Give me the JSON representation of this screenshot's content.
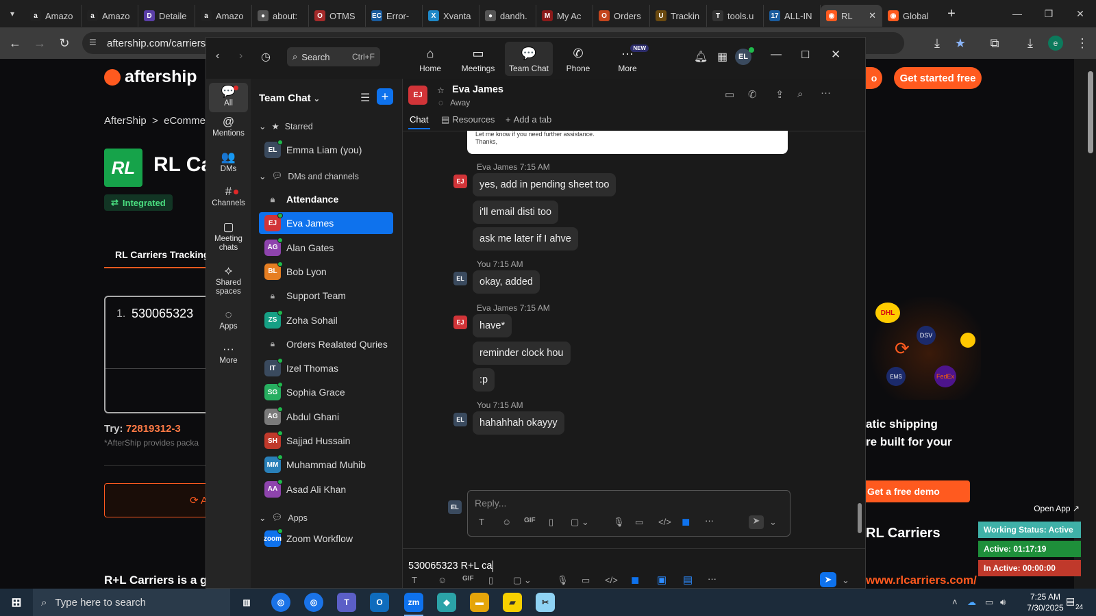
{
  "browser": {
    "tabs": [
      {
        "label": "Amazo",
        "fav": "a",
        "color": "#222"
      },
      {
        "label": "Amazo",
        "fav": "a",
        "color": "#222"
      },
      {
        "label": "Detaile",
        "fav": "D",
        "color": "#5a3ea6"
      },
      {
        "label": "Amazo",
        "fav": "a",
        "color": "#222"
      },
      {
        "label": "about:",
        "fav": "●",
        "color": "#555"
      },
      {
        "label": "OTMS",
        "fav": "O",
        "color": "#a42a2a"
      },
      {
        "label": "Error-",
        "fav": "EC",
        "color": "#1a5c9e"
      },
      {
        "label": "Xvanta",
        "fav": "X",
        "color": "#1e88c7"
      },
      {
        "label": "dandh.",
        "fav": "●",
        "color": "#555"
      },
      {
        "label": "My Ac",
        "fav": "M",
        "color": "#8b1a1a"
      },
      {
        "label": "Orders",
        "fav": "O",
        "color": "#c4451d"
      },
      {
        "label": "Trackin",
        "fav": "U",
        "color": "#6b4a10"
      },
      {
        "label": "tools.u",
        "fav": "T",
        "color": "#333"
      },
      {
        "label": "ALL-IN",
        "fav": "17",
        "color": "#1a5c9e"
      }
    ],
    "active_tab": {
      "label": "RL",
      "fav": "◉",
      "color": "#ff5a1f"
    },
    "last_tab": {
      "label": "Global",
      "fav": "◉",
      "color": "#ff5a1f"
    },
    "url": "aftership.com/carriers/r",
    "profile_initial": "e"
  },
  "bg_page": {
    "logo": "aftership",
    "breadcrumb": "AfterShip  >  eCommer",
    "carrier_title": "RL Ca",
    "carrier_logo": "RL",
    "integrated_badge": "Integrated",
    "tab_label": "RL Carriers Tracking",
    "tracking_index": "1.",
    "tracking_number": "530065323",
    "try_label": "Try:",
    "try_number": "72819312-3",
    "note": "*AfterShip provides packa",
    "footer_text": "R+L Carriers is a glo",
    "get_started": "Get started free",
    "partial_btn": "o",
    "promo_line1": "atic shipping",
    "promo_line2": "re built for your",
    "demo_button": "Get a free demo",
    "rl_carriers": "RL Carriers",
    "rl_url": "www.rlcarriers.com/",
    "carriers": [
      "DHL",
      "DSV",
      "FedEx",
      "EMS"
    ]
  },
  "zoom": {
    "topnav": [
      {
        "label": "Home",
        "icon": "⌂"
      },
      {
        "label": "Meetings",
        "icon": "▭"
      },
      {
        "label": "Team Chat",
        "icon": "💬"
      },
      {
        "label": "Phone",
        "icon": "✆"
      },
      {
        "label": "More",
        "icon": "···",
        "badge": "NEW"
      }
    ],
    "search_label": "Search",
    "search_shortcut": "Ctrl+F",
    "user_initials": "EL",
    "rail": [
      {
        "label": "All",
        "icon": "💬"
      },
      {
        "label": "Mentions",
        "icon": "@"
      },
      {
        "label": "DMs",
        "icon": "👥"
      },
      {
        "label": "Channels",
        "icon": "#"
      },
      {
        "label": "Meeting chats",
        "icon": "▢"
      },
      {
        "label": "Shared spaces",
        "icon": "⟡"
      },
      {
        "label": "Apps",
        "icon": "◌"
      },
      {
        "label": "More",
        "icon": "···"
      }
    ],
    "list_title": "Team Chat",
    "sections": {
      "starred": "Starred",
      "dms": "DMs and channels",
      "apps": "Apps"
    },
    "starred": [
      {
        "initials": "EL",
        "name": "Emma Liam (you)",
        "color": "#3a4a5e"
      }
    ],
    "contacts": [
      {
        "initials": "",
        "name": "Attendance",
        "type": "lock",
        "bold": true
      },
      {
        "initials": "EJ",
        "name": "Eva James",
        "color": "#d13438",
        "selected": true
      },
      {
        "initials": "AG",
        "name": "Alan Gates",
        "color": "#8e44ad"
      },
      {
        "initials": "BL",
        "name": "Bob Lyon",
        "color": "#e67e22"
      },
      {
        "initials": "",
        "name": "Support Team",
        "type": "lock"
      },
      {
        "initials": "ZS",
        "name": "Zoha Sohail",
        "color": "#16a085"
      },
      {
        "initials": "",
        "name": "Orders Realated Quries",
        "type": "lock"
      },
      {
        "initials": "IT",
        "name": "Izel Thomas",
        "color": "#3a4a5e"
      },
      {
        "initials": "SG",
        "name": "Sophia Grace",
        "color": "#27ae60"
      },
      {
        "initials": "AG",
        "name": "Abdul Ghani",
        "color": "#7a7a7a"
      },
      {
        "initials": "SH",
        "name": "Sajjad Hussain",
        "color": "#c0392b"
      },
      {
        "initials": "MM",
        "name": "Muhammad Muhib",
        "color": "#2980b9"
      },
      {
        "initials": "AA",
        "name": "Asad Ali Khan",
        "color": "#8e44ad"
      }
    ],
    "apps": [
      {
        "initials": "zoom",
        "name": "Zoom Workflow",
        "color": "#0e72ed"
      }
    ],
    "chat_header": {
      "initials": "EJ",
      "name": "Eva James",
      "status": "Away"
    },
    "chat_tabs": {
      "chat": "Chat",
      "resources": "Resources",
      "add": "Add a tab"
    },
    "attachment_lines": [
      "Let me know if you need further assistance.",
      "Thanks,"
    ],
    "messages": [
      {
        "sender": "Eva James",
        "time": "7:15 AM",
        "initials": "EJ",
        "lines": [
          "yes, add in pending sheet too",
          "i'll email disti too",
          "ask me later if I ahve"
        ]
      },
      {
        "sender": "You",
        "time": "7:15 AM",
        "initials": "EL",
        "lines": [
          "okay, added"
        ]
      },
      {
        "sender": "Eva James",
        "time": "7:15 AM",
        "initials": "EJ",
        "lines": [
          "have*",
          "reminder clock hou",
          ":p"
        ]
      },
      {
        "sender": "You",
        "time": "7:15 AM",
        "initials": "EL",
        "lines": [
          "hahahhah okayyy"
        ]
      }
    ],
    "reply_placeholder": "Reply...",
    "composer_text": "530065323 R+L ca"
  },
  "work_status": {
    "open_app": "Open App ↗",
    "status": "Working Status: Active",
    "active": "Active: 01:17:19",
    "inactive": "In Active: 00:00:00"
  },
  "taskbar": {
    "search_placeholder": "Type here to search",
    "time": "7:25 AM",
    "date": "7/30/2025",
    "notif_count": "24"
  }
}
